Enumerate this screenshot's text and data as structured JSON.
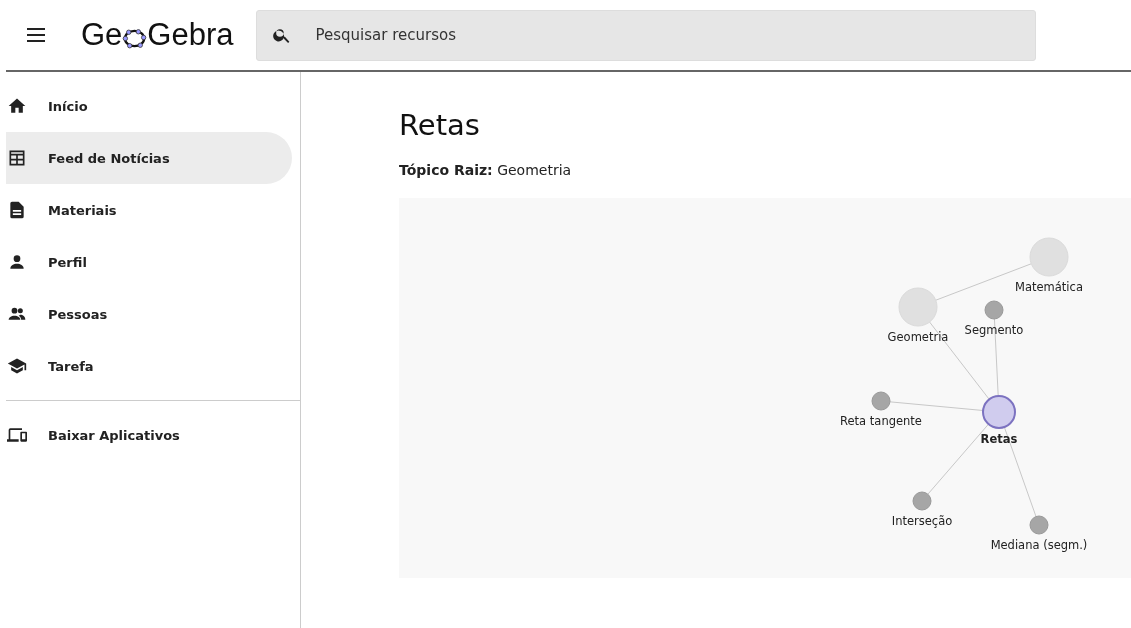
{
  "header": {
    "logo": {
      "before": "Ge",
      "after": "Gebra"
    },
    "search": {
      "placeholder": "Pesquisar recursos"
    }
  },
  "sidebar": {
    "items": [
      {
        "label": "Início",
        "kind": "home",
        "selected": false
      },
      {
        "label": "Feed de Notícias",
        "kind": "feed",
        "selected": true
      },
      {
        "label": "Materiais",
        "kind": "document",
        "selected": false
      },
      {
        "label": "Perfil",
        "kind": "person",
        "selected": false
      },
      {
        "label": "Pessoas",
        "kind": "people",
        "selected": false
      },
      {
        "label": "Tarefa",
        "kind": "school",
        "selected": false
      }
    ],
    "footer_items": [
      {
        "label": "Baixar Aplicativos",
        "kind": "devices",
        "selected": false
      }
    ]
  },
  "topic": {
    "title": "Retas",
    "root": "**Tópico Raiz:** Geometria"
  },
  "graph": {
    "nodes": [
      {
        "label": "Matemática",
        "kind": "ancestor",
        "children": [
          {
            "label": "Geometria",
            "kind": "ancestor",
            "children": [
              {
                "label": "Retas",
                "kind": "current",
                "children": [
                  {
                    "label": "Segmento",
                    "kind": "related"
                  },
                  {
                    "label": "Reta tangente",
                    "kind": "related"
                  },
                  {
                    "label": "Interseção",
                    "kind": "related"
                  },
                  {
                    "label": "Mediana (segm.)",
                    "kind": "related"
                  }
                ]
              }
            ]
          }
        ]
      }
    ]
  }
}
